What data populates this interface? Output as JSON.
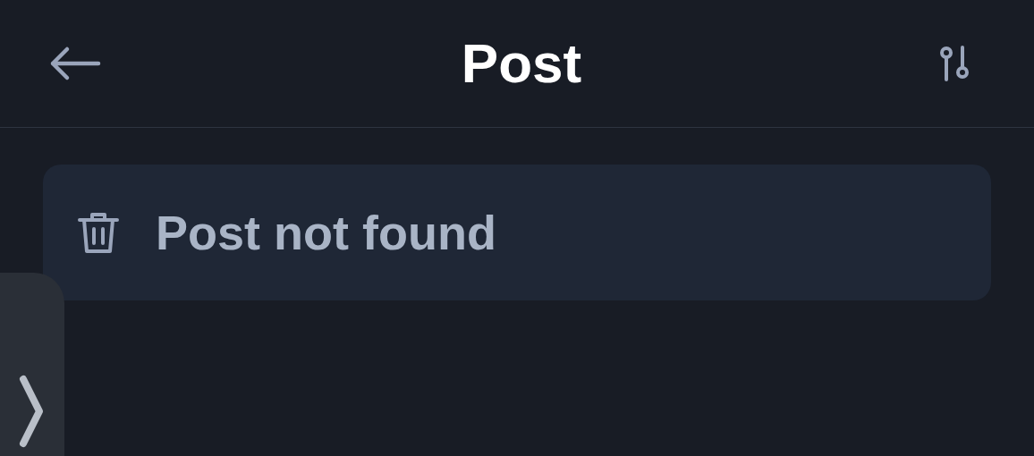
{
  "header": {
    "title": "Post"
  },
  "message": {
    "text": "Post not found"
  }
}
